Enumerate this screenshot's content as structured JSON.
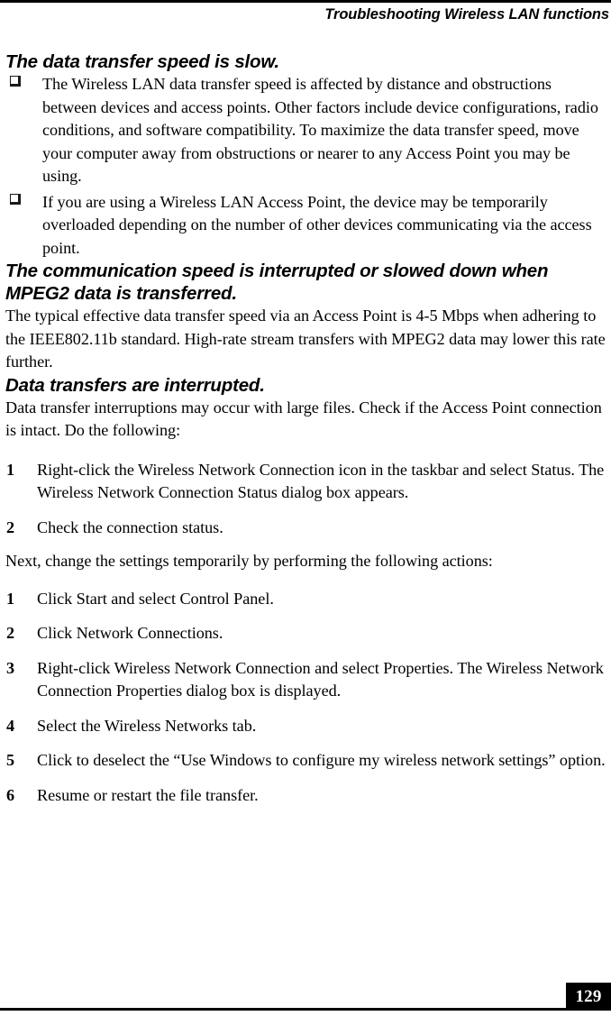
{
  "header": {
    "running_head": "Troubleshooting Wireless LAN functions"
  },
  "sections": [
    {
      "heading": "The data transfer speed is slow.",
      "bullets": [
        "The Wireless LAN data transfer speed is affected by distance and obstructions between devices and access points. Other factors include device configurations, radio conditions, and software compatibility. To maximize the data transfer speed, move your computer away from obstructions or nearer to any Access Point you may be using.",
        "If you are using a Wireless LAN Access Point, the device may be temporarily overloaded depending on the number of other devices communicating via the access point."
      ]
    },
    {
      "heading": "The communication speed is interrupted or slowed down when MPEG2 data is transferred.",
      "paragraph": "The typical effective data transfer speed via an Access Point is 4-5 Mbps when adhering to the IEEE802.11b standard. High-rate stream transfers with MPEG2 data may lower this rate further."
    },
    {
      "heading": "Data transfers are interrupted.",
      "intro": "Data transfer interruptions may occur with large files. Check if the Access Point connection is intact. Do the following:",
      "steps_first": [
        {
          "number": "1",
          "text": "Right-click the Wireless Network Connection icon in the taskbar and select Status. The Wireless Network Connection Status dialog box appears."
        },
        {
          "number": "2",
          "text": "Check the connection status."
        }
      ],
      "mid_paragraph": "Next, change the settings temporarily by performing the following actions:",
      "steps_second": [
        {
          "number": "1",
          "text": "Click Start and select Control Panel."
        },
        {
          "number": "2",
          "text": "Click Network Connections."
        },
        {
          "number": "3",
          "text": "Right-click Wireless Network Connection and select Properties. The Wireless Network Connection Properties dialog box is displayed."
        },
        {
          "number": "4",
          "text": "Select the Wireless Networks tab."
        },
        {
          "number": "5",
          "text": "Click to deselect the “Use Windows to configure my wireless network settings” option."
        },
        {
          "number": "6",
          "text": "Resume or restart the file transfer."
        }
      ]
    }
  ],
  "footer": {
    "page_number": "129"
  },
  "colors": {
    "ink": "#000000",
    "paper": "#ffffff"
  }
}
